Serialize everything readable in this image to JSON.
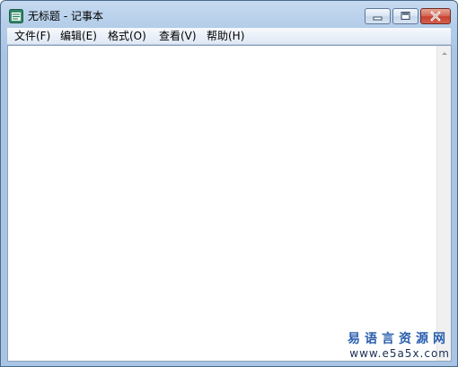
{
  "window": {
    "title": "无标题 - 记事本",
    "app_icon": "notepad-icon"
  },
  "caption_buttons": [
    {
      "name": "minimize",
      "icon": "minimize-icon"
    },
    {
      "name": "maximize",
      "icon": "maximize-icon"
    },
    {
      "name": "close",
      "icon": "close-icon"
    }
  ],
  "menubar": {
    "items": [
      {
        "label": "文件(F)"
      },
      {
        "label": "编辑(E)"
      },
      {
        "label": "格式(O)"
      },
      {
        "label": "查看(V)"
      },
      {
        "label": "帮助(H)"
      }
    ]
  },
  "editor": {
    "content": ""
  },
  "watermark": {
    "line1": "易语言资源网",
    "line2": "www.e5a5x.com"
  },
  "colors": {
    "title_frame": "#b4cde9",
    "close_button": "#c7402e",
    "watermark_blue": "#2a5fae"
  }
}
